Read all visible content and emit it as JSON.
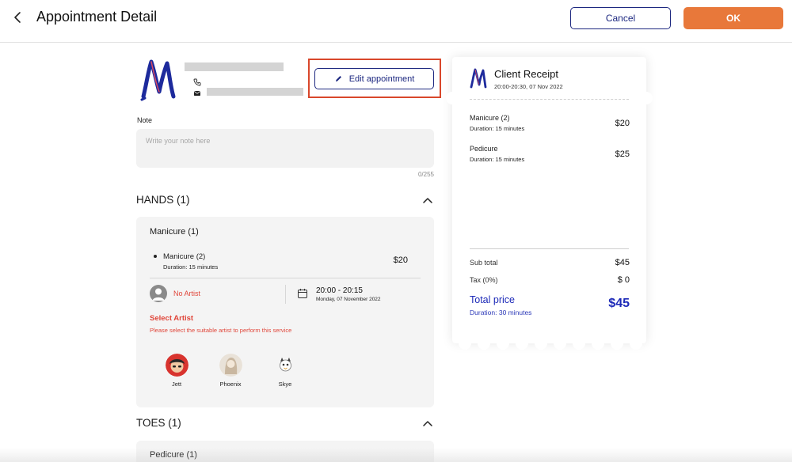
{
  "header": {
    "title": "Appointment Detail",
    "cancel_label": "Cancel",
    "ok_label": "OK"
  },
  "client": {
    "edit_label": "Edit appointment"
  },
  "note": {
    "label": "Note",
    "placeholder": "Write your note here",
    "counter": "0/255"
  },
  "sections": {
    "hands": {
      "title": "HANDS (1)",
      "group_name": "Manicure (1)",
      "item_name": "Manicure (2)",
      "item_duration": "Duration: 15 minutes",
      "item_price": "$20",
      "artist_status": "No Artist",
      "time_range": "20:00 - 20:15",
      "date": "Monday, 07 November 2022",
      "select_artist_title": "Select Artist",
      "select_artist_help": "Please select the suitable artist to perform this service",
      "artists": [
        {
          "name": "Jett"
        },
        {
          "name": "Phoenix"
        },
        {
          "name": "Skye"
        }
      ]
    },
    "toes": {
      "title": "TOES (1)",
      "group_name": "Pedicure (1)"
    }
  },
  "receipt": {
    "title": "Client Receipt",
    "subtitle": "20:00-20:30, 07 Nov 2022",
    "items": [
      {
        "name": "Manicure (2)",
        "duration": "Duration: 15 minutes",
        "price": "$20"
      },
      {
        "name": "Pedicure",
        "duration": "Duration: 15 minutes",
        "price": "$25"
      }
    ],
    "subtotal_label": "Sub total",
    "subtotal_value": "$45",
    "tax_label": "Tax (0%)",
    "tax_value": "$ 0",
    "total_label": "Total price",
    "total_duration": "Duration: 30 minutes",
    "total_value": "$45"
  },
  "colors": {
    "brand_blue": "#1d2880",
    "accent_orange": "#e8783a",
    "alert_red": "#e0463a",
    "highlight_outline": "#d9472b"
  },
  "icons": [
    "chevron-left-icon",
    "phone-icon",
    "mail-icon",
    "pencil-icon",
    "chevron-up-icon",
    "calendar-icon",
    "user-icon",
    "brand-logo"
  ]
}
